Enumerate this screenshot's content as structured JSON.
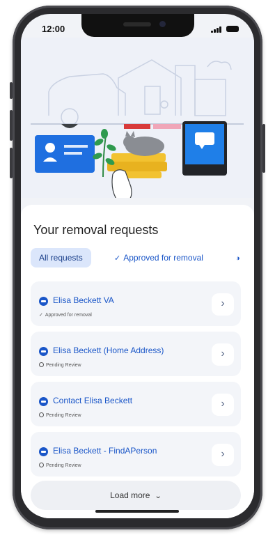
{
  "status_bar": {
    "time": "12:00"
  },
  "section": {
    "title": "Your removal requests"
  },
  "filters": [
    {
      "label": "All requests",
      "active": true
    },
    {
      "label": "Approved for removal",
      "active": false,
      "icon": "check-icon"
    },
    {
      "label": "",
      "active": false,
      "icon": "pending-icon"
    }
  ],
  "requests": [
    {
      "name": "Elisa Beckett VA",
      "status": "Approved for removal",
      "status_icon": "check-icon"
    },
    {
      "name": "Elisa Beckett (Home Address)",
      "status": "Pending Review",
      "status_icon": "pending-icon"
    },
    {
      "name": "Contact Elisa Beckett",
      "status": "Pending Review",
      "status_icon": "pending-icon"
    },
    {
      "name": "Elisa Beckett - FindAPerson",
      "status": "Pending Review",
      "status_icon": "pending-icon"
    }
  ],
  "load_more": {
    "label": "Load more"
  },
  "colors": {
    "accent": "#1a56c8",
    "chip_active_bg": "#dbe6fb",
    "hero_bg": "#eef1f8",
    "id_card": "#1f6fe0",
    "phone_screen": "#1f7fe8"
  }
}
